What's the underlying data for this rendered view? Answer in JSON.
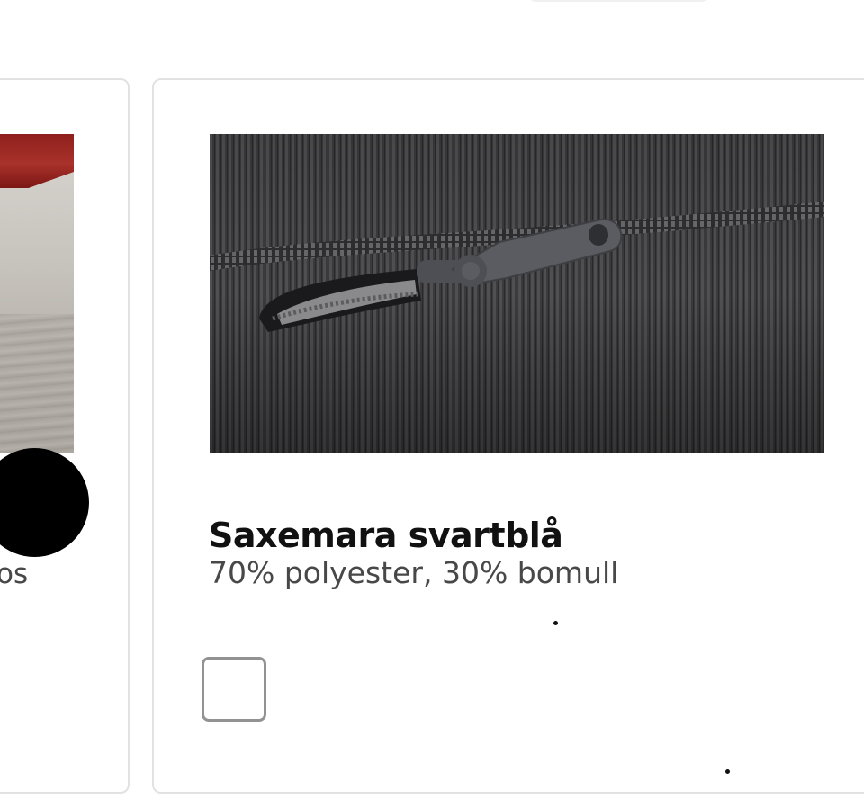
{
  "left_card": {
    "caption_fragment": "os",
    "swatch_color": "#000000",
    "image_icon": "red-sofa-photo"
  },
  "right_card": {
    "image_icon": "corduroy-cushion-zipper-photo",
    "title": "Saxemara svartblå",
    "description": "70% polyester, 30% bomull",
    "checkbox_checked": false
  },
  "colors": {
    "card_border": "#e2e2e2",
    "title_text": "#111111",
    "body_text": "#484848",
    "checkbox_border": "#929292"
  }
}
